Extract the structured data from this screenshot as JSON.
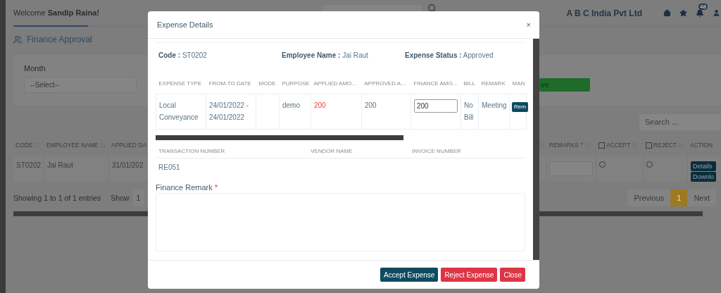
{
  "header": {
    "welcome": "Welcome **Sandip Raina!**",
    "company": "A B C India Pvt Ltd",
    "notification_count": "48"
  },
  "page_title": "Finance Approval",
  "filter": {
    "label": "Month",
    "select_value": "--Select--",
    "button_label": "ve"
  },
  "search": {
    "placeholder": "Search ..."
  },
  "table": {
    "left_columns": [
      "CODE",
      "EMPLOYEE NAME",
      "APPLIED DA"
    ],
    "right_columns": [
      {
        "label": "REMARKS",
        "kind": "text",
        "required_mark": "*"
      },
      {
        "label": "ACCEPT",
        "kind": "checkbox",
        "checked": false
      },
      {
        "label": "REJECT",
        "kind": "checkbox",
        "checked": false
      },
      {
        "label": "ACTION",
        "kind": "text"
      }
    ],
    "rows": [
      {
        "code": "ST0202",
        "employee": "Jai Raut",
        "applied": "31/01/202",
        "accept": false,
        "reject": false,
        "actions": [
          "Details",
          "Downlo"
        ]
      }
    ]
  },
  "footer": {
    "info": "Showing 1 to 1 of 1 entries",
    "show_label": "Show",
    "page_size": "1"
  },
  "pagination": [
    {
      "label": "Previous",
      "selected": false
    },
    {
      "label": "1",
      "selected": true
    },
    {
      "label": "Next",
      "selected": false
    }
  ],
  "modal": {
    "title": "Expense Details",
    "close": "×",
    "info": [
      {
        "label": "Code :",
        "value": "ST0202"
      },
      {
        "label": "Employee Name :",
        "value": "Jai Raut"
      },
      {
        "label": "Expense Status :",
        "value": "Approved"
      }
    ],
    "expense_table": {
      "columns": [
        "EXPENSE TYPE",
        "FROM-TO DATE",
        "MODE",
        "PURPOSE",
        "APPLIED AMO…",
        "APPROVED A…",
        "FINANCE AMO…",
        "BILL",
        "REMARK",
        "MAN"
      ],
      "rows": [
        {
          "cells": [
            {
              "kind": "text",
              "text": "Local Conveyance"
            },
            {
              "kind": "text",
              "text": "24/01/2022 - 24/01/2022"
            },
            {
              "kind": "empty"
            },
            {
              "kind": "text",
              "text": "demo"
            },
            {
              "kind": "alert",
              "text": "200"
            },
            {
              "kind": "text",
              "text": "200"
            },
            {
              "kind": "input",
              "value": "200"
            },
            {
              "kind": "text",
              "text": "No Bill"
            },
            {
              "kind": "text",
              "text": "Meeting"
            },
            {
              "kind": "button",
              "text": "Rem"
            }
          ]
        }
      ]
    },
    "transaction_table": {
      "columns": [
        "TRANSACTION NUMBER",
        "VENDOR NAME",
        "INVOICE NUMBER"
      ],
      "rows": [
        {
          "transaction": "RE051"
        }
      ]
    },
    "remark": {
      "label": "Finance Remark",
      "required_mark": "*"
    },
    "buttons": [
      {
        "label": "Accept Expense",
        "kind": "primary"
      },
      {
        "label": "Reject Expense",
        "kind": "danger"
      },
      {
        "label": "Close",
        "kind": "danger"
      }
    ]
  }
}
